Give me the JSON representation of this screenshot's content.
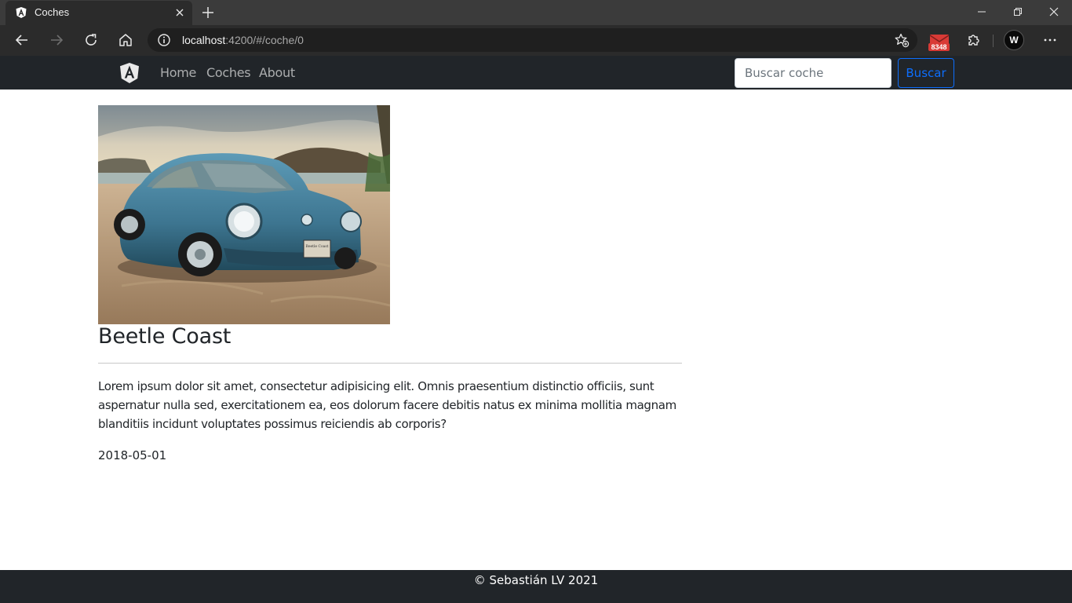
{
  "browser": {
    "tab_title": "Coches",
    "url_host": "localhost",
    "url_rest": ":4200/#/coche/0",
    "mail_count": "8348",
    "profile_initial": "W"
  },
  "navbar": {
    "links": [
      "Home",
      "Coches",
      "About"
    ],
    "search_placeholder": "Buscar coche",
    "search_button": "Buscar"
  },
  "car": {
    "title": "Beetle Coast",
    "description": "Lorem ipsum dolor sit amet, consectetur adipisicing elit. Omnis praesentium distinctio officiis, sunt aspernatur nulla sed, exercitationem ea, eos dolorum facere debitis natus ex minima mollitia magnam blanditiis incidunt voluptates possimus reiciendis ab corporis?",
    "date": "2018-05-01",
    "plate_text": "Beetle Coast"
  },
  "footer": {
    "text": "© Sebastián LV 2021"
  },
  "colors": {
    "navbar_bg": "#212529",
    "accent": "#0d6efd",
    "car_body": "#3f7f9c"
  },
  "icons": [
    "angular-logo-icon",
    "close-icon",
    "plus-icon",
    "minimize-icon",
    "restore-icon",
    "back-icon",
    "forward-icon",
    "refresh-icon",
    "home-icon",
    "info-icon",
    "add-favorite-icon",
    "mail-icon",
    "extensions-icon",
    "more-icon"
  ]
}
